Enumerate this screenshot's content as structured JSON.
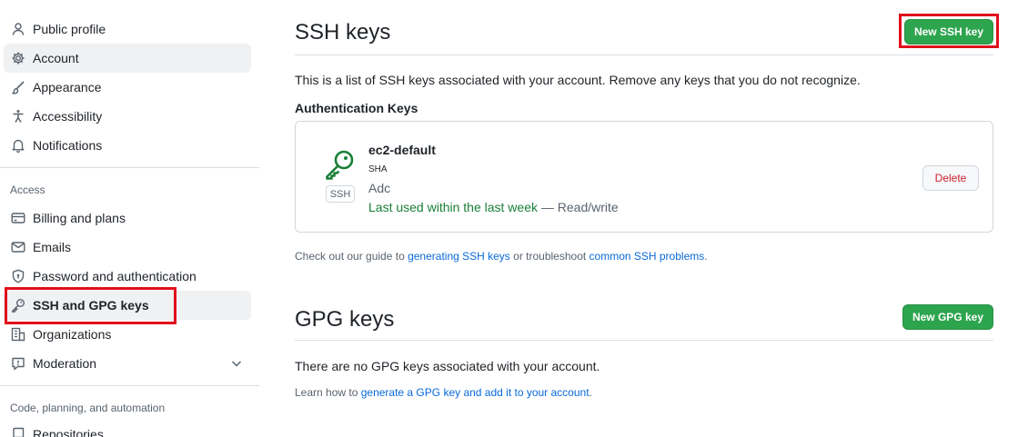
{
  "sidebar": {
    "items": [
      {
        "label": "Public profile",
        "icon": "person-icon"
      },
      {
        "label": "Account",
        "icon": "gear-icon"
      },
      {
        "label": "Appearance",
        "icon": "paintbrush-icon"
      },
      {
        "label": "Accessibility",
        "icon": "accessibility-icon"
      },
      {
        "label": "Notifications",
        "icon": "bell-icon"
      }
    ],
    "access_label": "Access",
    "access_items": [
      {
        "label": "Billing and plans",
        "icon": "credit-card-icon"
      },
      {
        "label": "Emails",
        "icon": "mail-icon"
      },
      {
        "label": "Password and authentication",
        "icon": "shield-lock-icon"
      },
      {
        "label": "SSH and GPG keys",
        "icon": "key-icon"
      },
      {
        "label": "Organizations",
        "icon": "organization-icon"
      },
      {
        "label": "Moderation",
        "icon": "report-icon"
      }
    ],
    "code_label": "Code, planning, and automation",
    "code_items": [
      {
        "label": "Repositories",
        "icon": "repo-icon"
      }
    ]
  },
  "ssh": {
    "title": "SSH keys",
    "new_button": "New SSH key",
    "description": "This is a list of SSH keys associated with your account. Remove any keys that you do not recognize.",
    "auth_heading": "Authentication Keys",
    "key": {
      "name": "ec2-default",
      "badge": "SSH",
      "sha": "SHA",
      "added": "Adc",
      "last_used": "Last used within the last week",
      "access": " — Read/write",
      "delete_label": "Delete"
    },
    "help_prefix": "Check out our guide to ",
    "help_link1": "generating SSH keys",
    "help_mid": " or troubleshoot ",
    "help_link2": "common SSH problems",
    "help_suffix": "."
  },
  "gpg": {
    "title": "GPG keys",
    "new_button": "New GPG key",
    "empty": "There are no GPG keys associated with your account.",
    "help_prefix": "Learn how to ",
    "help_link": "generate a GPG key and add it to your account",
    "help_suffix": "."
  },
  "colors": {
    "accent_green": "#2da44e",
    "link_blue": "#0969da",
    "highlight_red": "#e0101c",
    "danger_red": "#cf222e",
    "success_green": "#1a7f37"
  }
}
